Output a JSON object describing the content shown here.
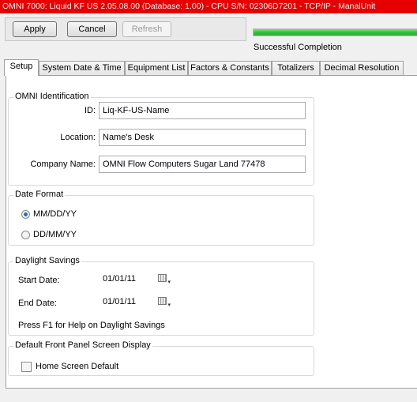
{
  "window": {
    "title": "OMNI 7000:  Liquid KF US 2.05.08.00 (Database: 1.00) - CPU S/N: 02306D7201 - TCP/IP - ManalUnit"
  },
  "toolbar": {
    "apply_label": "Apply",
    "cancel_label": "Cancel",
    "refresh_label": "Refresh",
    "progress_fraction": 1.0,
    "status_text": "Successful Completion",
    "progress_color": "#2fbf3a"
  },
  "tabs": [
    {
      "label": "Setup",
      "active": true
    },
    {
      "label": "System Date & Time"
    },
    {
      "label": "Equipment List"
    },
    {
      "label": "Factors & Constants"
    },
    {
      "label": "Totalizers"
    },
    {
      "label": "Decimal Resolution"
    }
  ],
  "identification": {
    "title": "OMNI Identification",
    "id_label": "ID:",
    "id_value": "Liq-KF-US-Name",
    "location_label": "Location:",
    "location_value": "Name's Desk",
    "company_label": "Company Name:",
    "company_value": "OMNI Flow Computers Sugar Land 77478"
  },
  "date_format": {
    "title": "Date Format",
    "option1": "MM/DD/YY",
    "option2": "DD/MM/YY",
    "selected": "MM/DD/YY"
  },
  "daylight": {
    "title": "Daylight Savings",
    "start_label": "Start Date:",
    "start_value": "01/01/11",
    "end_label": "End Date:",
    "end_value": "01/01/11",
    "help_text": "Press F1 for Help on Daylight Savings"
  },
  "front_panel": {
    "title": "Default Front Panel Screen Display",
    "home_label": "Home Screen Default",
    "home_checked": false
  }
}
